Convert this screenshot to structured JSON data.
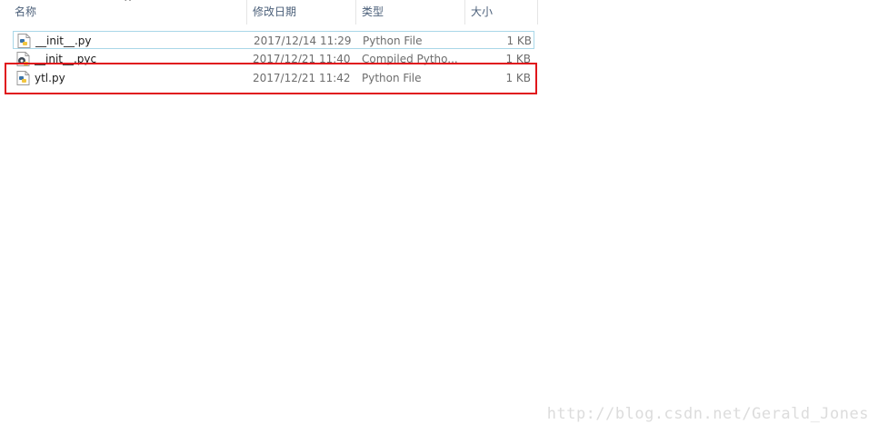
{
  "columns": {
    "name": "名称",
    "date": "修改日期",
    "type": "类型",
    "size": "大小"
  },
  "sort_indicator": "^",
  "files": [
    {
      "name": "__init__.py",
      "modified": "2017/12/14 11:29",
      "type": "Python File",
      "size": "1 KB",
      "icon": "python-file-icon",
      "state": "hovered"
    },
    {
      "name": "__init__.pyc",
      "modified": "2017/12/21 11:40",
      "type": "Compiled Pytho...",
      "size": "1 KB",
      "icon": "compiled-python-file-icon",
      "state": "normal"
    },
    {
      "name": "ytl.py",
      "modified": "2017/12/21 11:42",
      "type": "Python File",
      "size": "1 KB",
      "icon": "python-file-icon",
      "state": "highlighted"
    }
  ],
  "watermark": "http://blog.csdn.net/Gerald_Jones",
  "colors": {
    "highlight_border": "#e0161b",
    "hover_border": "#a9d7e8",
    "header_text": "#4c607a"
  }
}
